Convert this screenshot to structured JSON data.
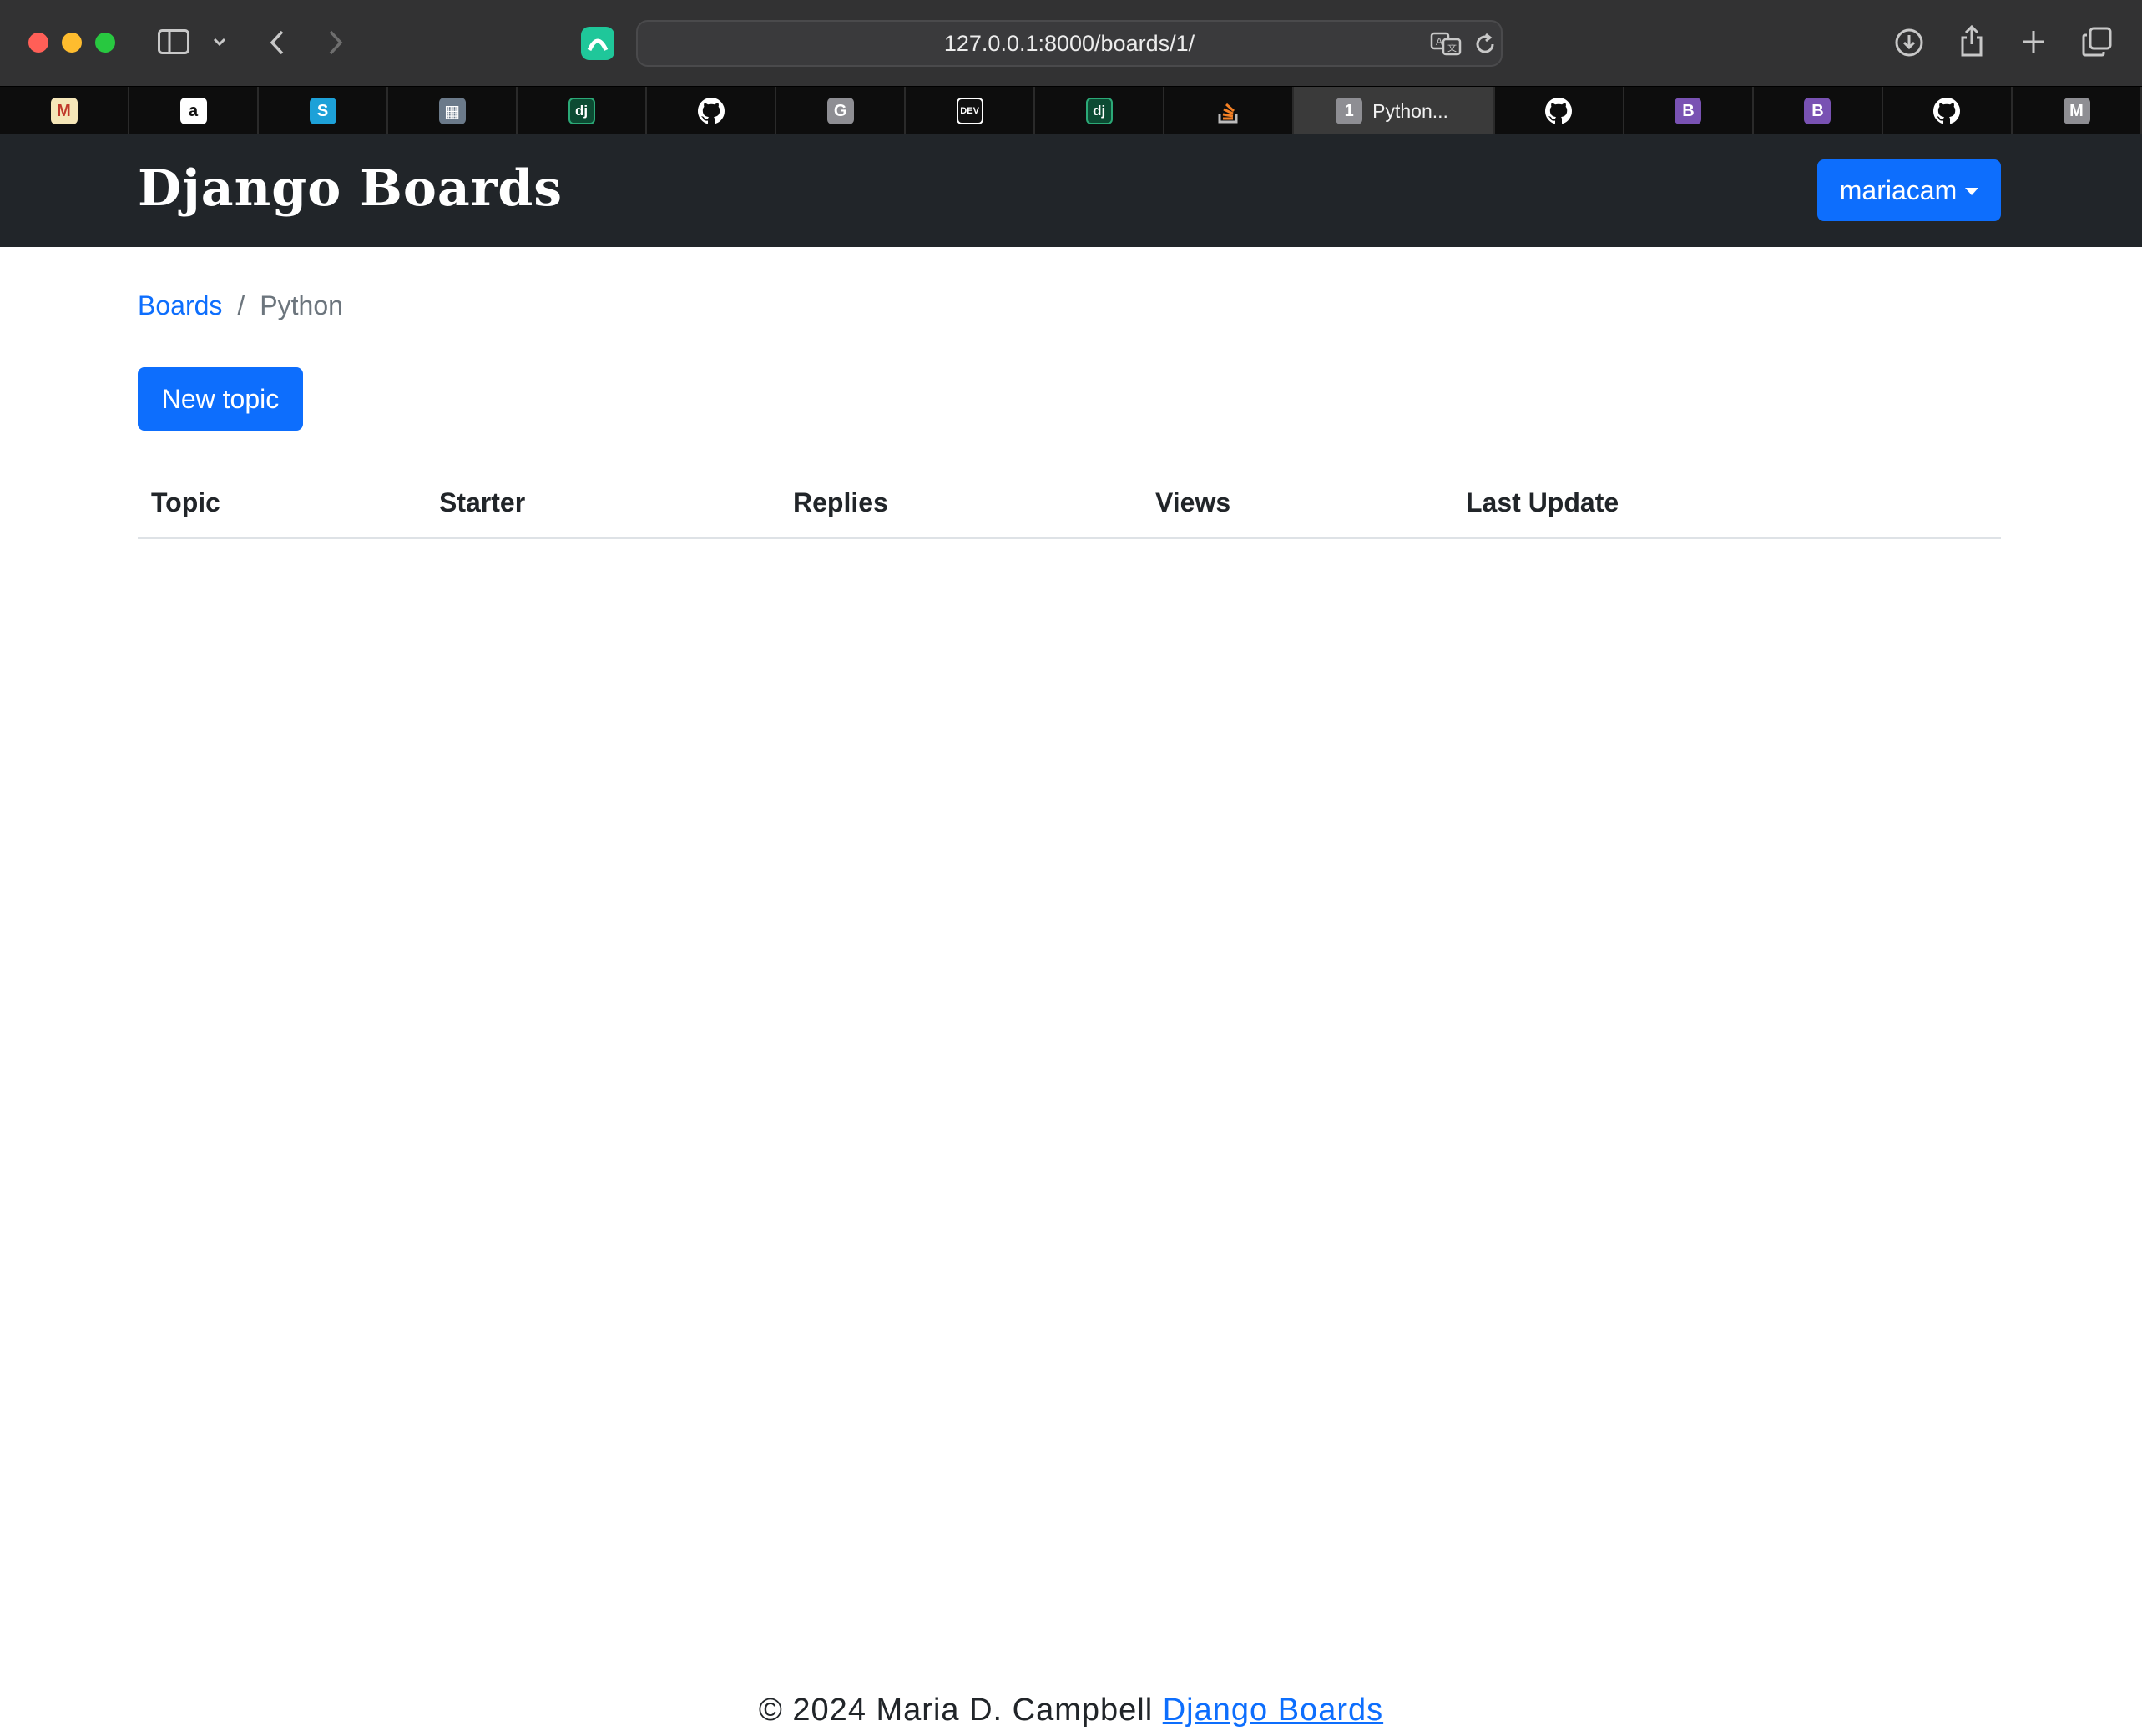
{
  "browser": {
    "url": "127.0.0.1:8000/boards/1/",
    "tabs": [
      {
        "icon": "M",
        "bg": "#f5e6b8",
        "fg": "#c0392b"
      },
      {
        "icon": "a",
        "bg": "#ffffff",
        "fg": "#111111"
      },
      {
        "icon": "S",
        "bg": "#1da1d8",
        "fg": "#ffffff"
      },
      {
        "icon": "▦",
        "bg": "#6b7a8a",
        "fg": "#ffffff"
      },
      {
        "icon": "dj",
        "bg": "#0c4b33",
        "fg": "#ffffff"
      },
      {
        "icon": "github",
        "bg": "transparent",
        "fg": "#ffffff"
      },
      {
        "icon": "G",
        "bg": "#8e8e93",
        "fg": "#ffffff"
      },
      {
        "icon": "DEV",
        "bg": "#111111",
        "fg": "#ffffff"
      },
      {
        "icon": "dj",
        "bg": "#0c4b33",
        "fg": "#ffffff"
      },
      {
        "icon": "stack",
        "bg": "transparent",
        "fg": "#f48024"
      },
      {
        "icon": "1",
        "bg": "#8e8e93",
        "fg": "#ffffff",
        "label": "Python...",
        "active": true
      },
      {
        "icon": "github",
        "bg": "transparent",
        "fg": "#ffffff"
      },
      {
        "icon": "B",
        "bg": "#7952b3",
        "fg": "#ffffff"
      },
      {
        "icon": "B",
        "bg": "#7952b3",
        "fg": "#ffffff"
      },
      {
        "icon": "github",
        "bg": "transparent",
        "fg": "#ffffff"
      },
      {
        "icon": "M",
        "bg": "#8e8e93",
        "fg": "#ffffff"
      }
    ]
  },
  "navbar": {
    "brand": "Django Boards",
    "user": "mariacam"
  },
  "breadcrumb": {
    "parent": "Boards",
    "separator": "/",
    "current": "Python"
  },
  "actions": {
    "new_topic": "New topic"
  },
  "table": {
    "headers": [
      "Topic",
      "Starter",
      "Replies",
      "Views",
      "Last Update"
    ]
  },
  "footer": {
    "copyright": "© 2024 Maria D. Campbell",
    "link": "Django Boards"
  },
  "colors": {
    "primary": "#0d6efd",
    "navbar": "#212529"
  }
}
